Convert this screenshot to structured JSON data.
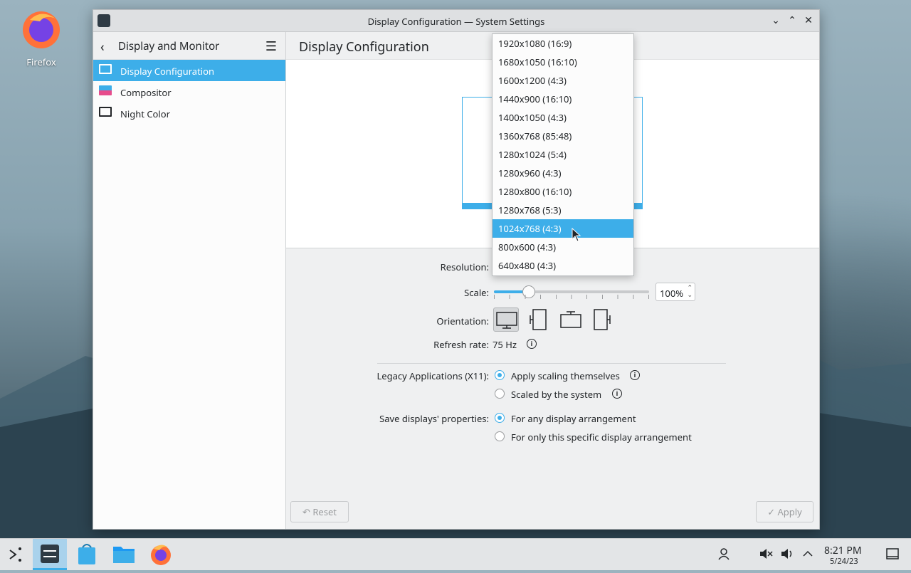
{
  "desktop": {
    "firefox_label": "Firefox"
  },
  "window": {
    "title": "Display Configuration — System Settings"
  },
  "sidebar": {
    "title": "Display and Monitor",
    "items": [
      {
        "label": "Display Configuration"
      },
      {
        "label": "Compositor"
      },
      {
        "label": "Night Color"
      }
    ]
  },
  "main": {
    "title": "Display Configuration",
    "resolution_label": "Resolution:",
    "scale_label": "Scale:",
    "scale_value": "100%",
    "scale_fraction": 0.22,
    "orientation_label": "Orientation:",
    "refresh_label": "Refresh rate:",
    "refresh_value": "75 Hz",
    "legacy_label": "Legacy Applications (X11):",
    "legacy_option1": "Apply scaling themselves",
    "legacy_option2": "Scaled by the system",
    "save_label": "Save displays' properties:",
    "save_option1": "For any display arrangement",
    "save_option2": "For only this specific display arrangement",
    "reset_label": "Reset",
    "apply_label": "Apply"
  },
  "resolution_dropdown": {
    "options": [
      "1920x1080 (16:9)",
      "1680x1050 (16:10)",
      "1600x1200 (4:3)",
      "1440x900 (16:10)",
      "1400x1050 (4:3)",
      "1360x768 (85:48)",
      "1280x1024 (5:4)",
      "1280x960 (4:3)",
      "1280x800 (16:10)",
      "1280x768 (5:3)",
      "1024x768 (4:3)",
      "800x600 (4:3)",
      "640x480 (4:3)"
    ],
    "highlighted": "1024x768 (4:3)"
  },
  "taskbar": {
    "time": "8:21 PM",
    "date": "5/24/23"
  },
  "colors": {
    "accent": "#3daee9"
  }
}
